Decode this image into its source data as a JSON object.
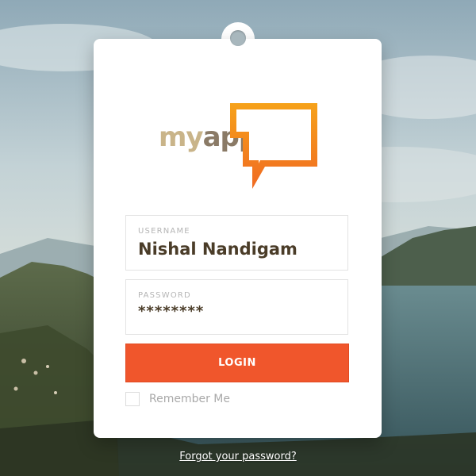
{
  "logo": {
    "word_my": "my",
    "word_app": "app",
    "colors": {
      "my": "#c9b489",
      "app": "#8a7a66",
      "bubble_top": "#f6a21a",
      "bubble_bottom": "#f06a22"
    }
  },
  "form": {
    "username": {
      "label": "USERNAME",
      "value": "Nishal Nandigam"
    },
    "password": {
      "label": "PASSWORD",
      "value": "********"
    },
    "login_label": "LOGIN",
    "remember_label": "Remember Me",
    "remember_checked": false
  },
  "forgot_link": "Forgot your password?",
  "colors": {
    "accent": "#f0562c",
    "card": "#ffffff"
  }
}
